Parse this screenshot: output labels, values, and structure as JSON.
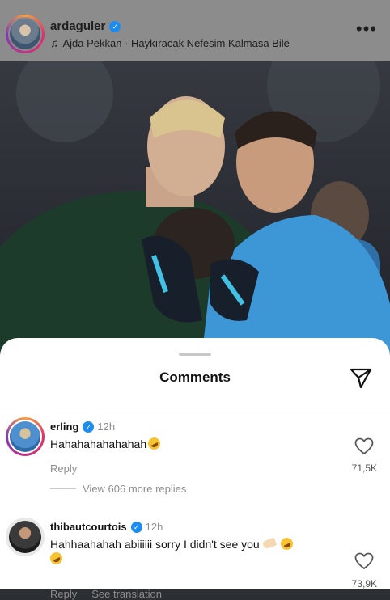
{
  "post": {
    "username": "ardaguler",
    "song": "Ajda Pekkan · Haykıracak Nefesim Kalmasa Bile"
  },
  "comments_sheet": {
    "title": "Comments",
    "items": [
      {
        "username": "erling",
        "time": "12h",
        "text": "Hahahahahahahah",
        "reply": "Reply",
        "likes": "71,5K",
        "view_replies": "View 606 more replies"
      },
      {
        "username": "thibautcourtois",
        "time": "12h",
        "text": "Hahhaahahah abiiiiii sorry I didn't see you",
        "reply": "Reply",
        "translation": "See translation",
        "likes": "73,9K"
      }
    ]
  },
  "colors": {
    "verified": "#1d8cf0",
    "header_overlay": "#8c8c8c",
    "home_kit": "#1c3b2b",
    "keeper_kit": "#3d97d6"
  }
}
